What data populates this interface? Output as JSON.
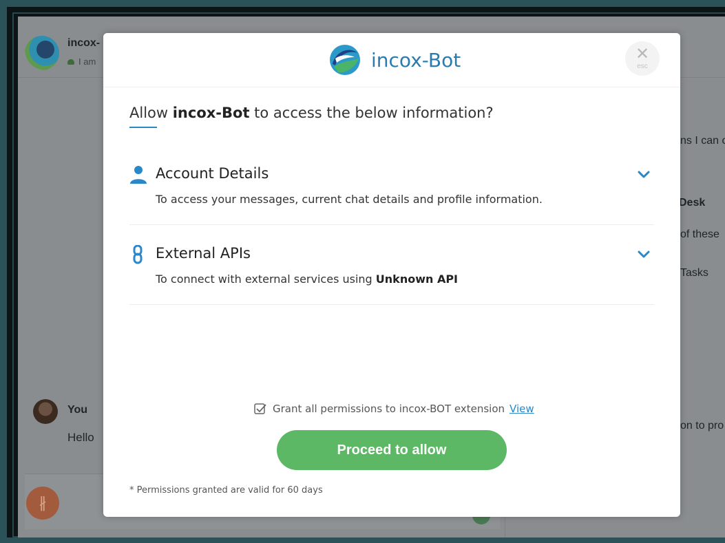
{
  "background": {
    "chat_name": "incox-",
    "chat_status": "I am",
    "right_snippets": [
      "ns I can c",
      "Desk",
      "of these",
      "Tasks",
      "on to pro"
    ],
    "you_label": "You",
    "hello_text": "Hello"
  },
  "modal": {
    "brand_name": "incox-Bot",
    "close_label": "esc",
    "question": {
      "prefix": "Allow ",
      "bot": "incox-Bot",
      "suffix": " to access the below information?"
    },
    "permissions": [
      {
        "icon": "user-icon",
        "title": "Account Details",
        "description": "To access your messages, current chat details and profile information.",
        "description_bold": ""
      },
      {
        "icon": "link-icon",
        "title": "External APIs",
        "description": "To connect with external services using ",
        "description_bold": "Unknown API"
      }
    ],
    "grant_text": "Grant all permissions to incox-BOT extension",
    "grant_link": "View",
    "proceed_label": "Proceed to allow",
    "footnote": "* Permissions granted are valid for 60 days"
  },
  "colors": {
    "accent": "#2a87c8",
    "brand": "#2a7bb0",
    "proceed": "#5cb865"
  }
}
